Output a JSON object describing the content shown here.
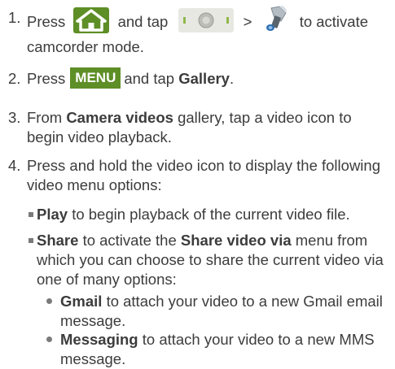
{
  "steps": [
    {
      "number": "1.",
      "press": "Press",
      "and_tap": "and tap",
      "gt": ">",
      "rest_line1": "to activate",
      "rest_line2": "camcorder mode.",
      "icons": [
        "home-key-icon",
        "camera-mode-switch-icon",
        "camcorder-icon"
      ]
    },
    {
      "number": "2.",
      "press": "Press",
      "key_label": "MENU",
      "and_tap": "and tap",
      "target": "Gallery",
      "end": "."
    },
    {
      "number": "3.",
      "from": "From",
      "bold": "Camera videos",
      "rest": "gallery, tap a video icon to begin video playback."
    },
    {
      "number": "4.",
      "text": "Press and hold the video icon to display the following video menu options:"
    }
  ],
  "options": [
    {
      "bold": "Play",
      "rest": "to begin playback of the current video file."
    },
    {
      "bold": "Share",
      "mid": "to activate the",
      "bold2": "Share video via",
      "rest": "menu from which you can choose to share the current video via one of many options:"
    }
  ],
  "share_options": [
    {
      "bold": "Gmail",
      "rest": "to attach your video to a new Gmail email message."
    },
    {
      "bold": "Messaging",
      "rest": "to attach your video to a new MMS message."
    }
  ],
  "colors": {
    "key_green": "#5e8e26",
    "body_text": "#3c3c3c",
    "bullet": "#7a7a7a"
  }
}
